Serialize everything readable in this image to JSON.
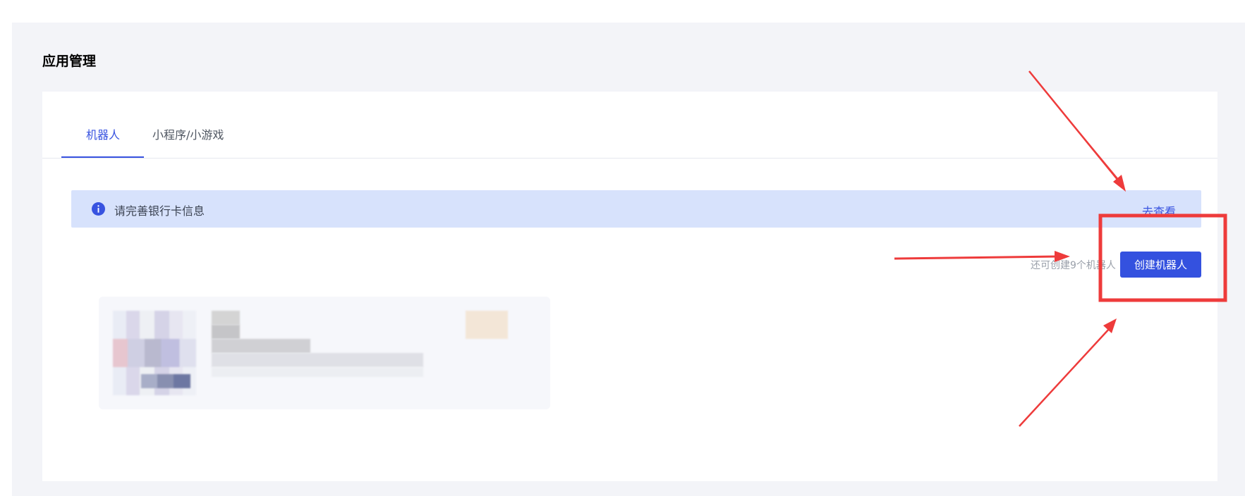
{
  "page": {
    "title": "应用管理"
  },
  "tabs": [
    {
      "label": "机器人",
      "active": true
    },
    {
      "label": "小程序/小游戏",
      "active": false
    }
  ],
  "notice": {
    "icon": "info-icon",
    "text": "请完善银行卡信息",
    "link": "去查看"
  },
  "actions": {
    "quota_text": "还可创建9个机器人",
    "create_label": "创建机器人"
  },
  "colors": {
    "accent": "#3853e0",
    "button": "#3451df",
    "notice_bg": "#d7e2fc",
    "page_bg": "#f3f4f8",
    "annotation": "#ee3b3b"
  }
}
